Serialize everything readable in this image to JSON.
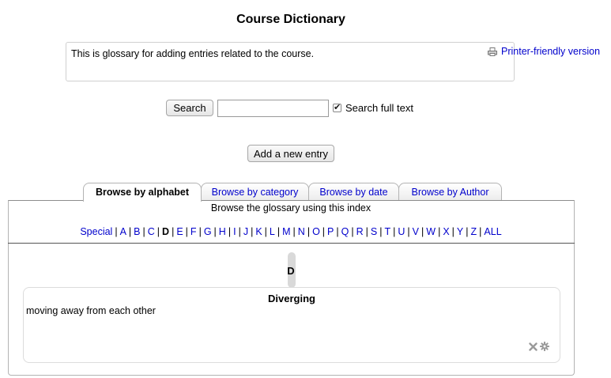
{
  "page": {
    "title": "Course Dictionary"
  },
  "intro": {
    "text": "This is glossary for adding entries related to the course."
  },
  "printer": {
    "label": "Printer-friendly version",
    "icon": "printer-icon"
  },
  "search": {
    "button_label": "Search",
    "input_value": "",
    "fulltext_label": "Search full text",
    "fulltext_checked": true
  },
  "add_entry": {
    "label": "Add a new entry"
  },
  "tabs": [
    {
      "label": "Browse by alphabet",
      "active": true
    },
    {
      "label": "Browse by category",
      "active": false
    },
    {
      "label": "Browse by date",
      "active": false
    },
    {
      "label": "Browse by Author",
      "active": false
    }
  ],
  "browse": {
    "hint": "Browse the glossary using this index",
    "index": [
      "Special",
      "A",
      "B",
      "C",
      "D",
      "E",
      "F",
      "G",
      "H",
      "I",
      "J",
      "K",
      "L",
      "M",
      "N",
      "O",
      "P",
      "Q",
      "R",
      "S",
      "T",
      "U",
      "V",
      "W",
      "X",
      "Y",
      "Z",
      "ALL"
    ],
    "current": "D"
  },
  "section": {
    "letter": "D"
  },
  "entry": {
    "concept": "Diverging",
    "definition": "moving away from each other",
    "icons": [
      "delete-icon",
      "settings-icon"
    ]
  },
  "colors": {
    "link": "#0000cc"
  }
}
